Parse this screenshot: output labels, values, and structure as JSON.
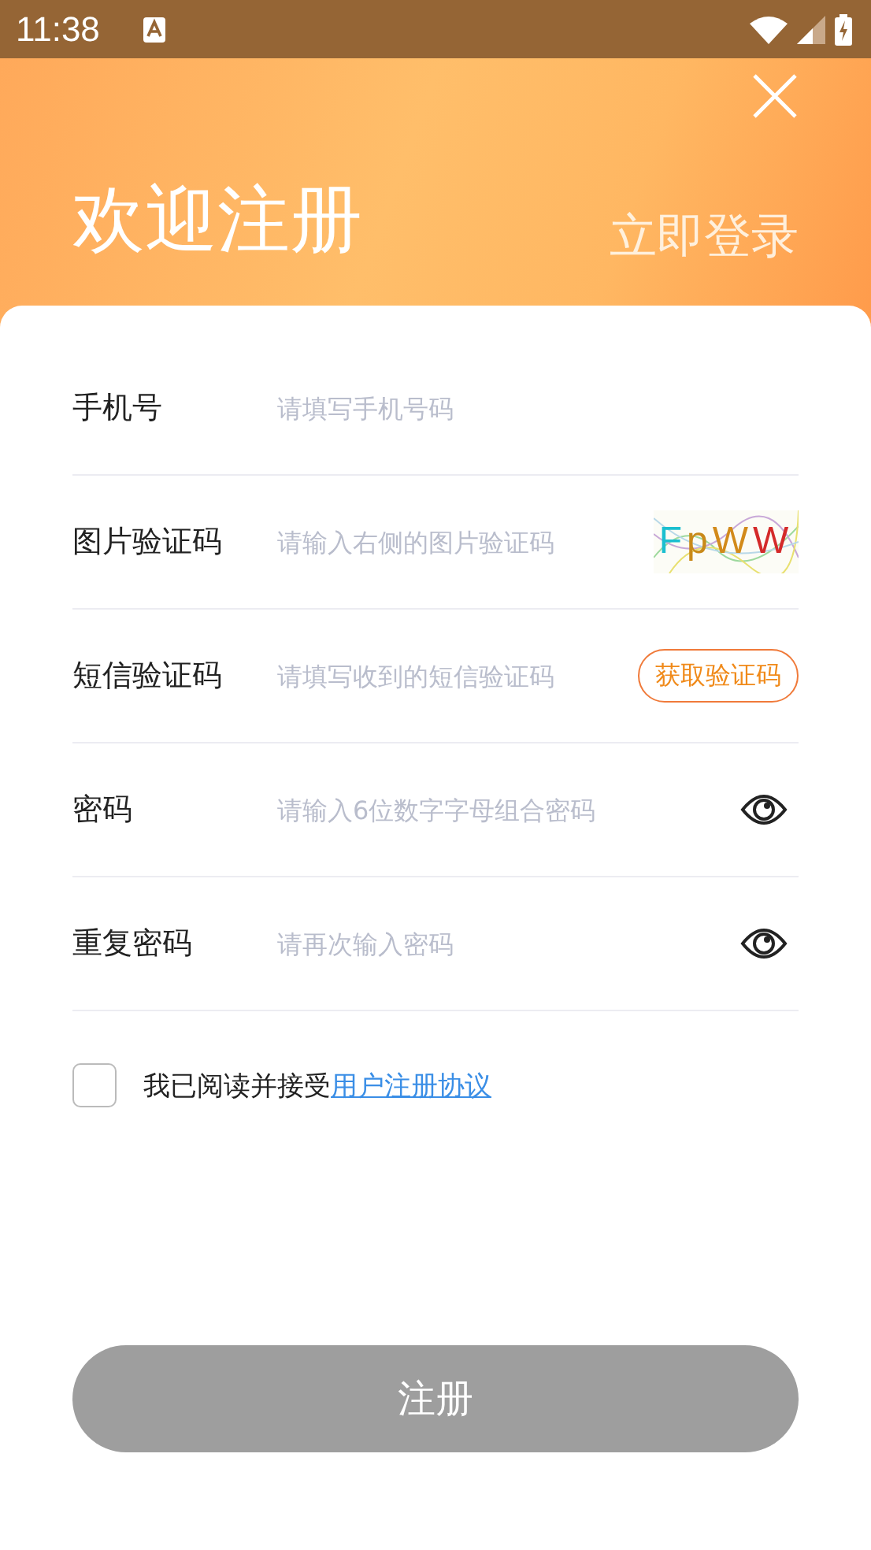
{
  "status_bar": {
    "time": "11:38"
  },
  "header": {
    "title": "欢迎注册",
    "login_link": "立即登录"
  },
  "fields": [
    {
      "kind": "plain",
      "label": "手机号",
      "placeholder": "请填写手机号码"
    },
    {
      "kind": "captcha",
      "label": "图片验证码",
      "placeholder": "请输入右侧的图片验证码",
      "captcha": "FpWW"
    },
    {
      "kind": "sms",
      "label": "短信验证码",
      "placeholder": "请填写收到的短信验证码",
      "button": "获取验证码"
    },
    {
      "kind": "password",
      "label": "密码",
      "placeholder": "请输入6位数字字母组合密码"
    },
    {
      "kind": "password",
      "label": "重复密码",
      "placeholder": "请再次输入密码"
    }
  ],
  "agreement": {
    "checked": false,
    "text": "我已阅读并接受",
    "link": "用户注册协议"
  },
  "submit": {
    "label": "注册",
    "disabled": true
  }
}
